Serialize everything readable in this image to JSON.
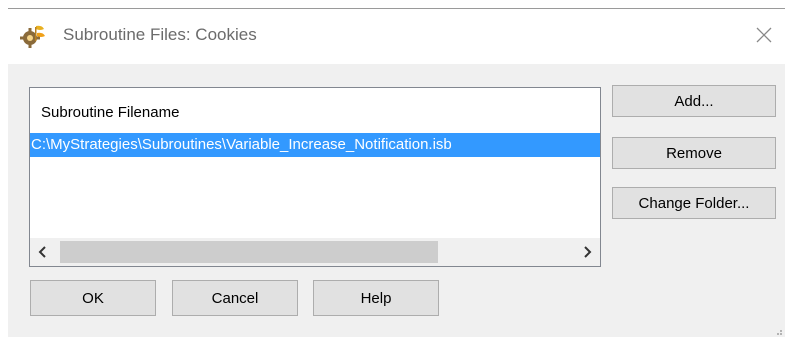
{
  "window": {
    "title": "Subroutine Files: Cookies",
    "app_icon": "gear-plant-icon",
    "close_icon": "close-icon"
  },
  "list": {
    "header": "Subroutine Filename",
    "items": [
      {
        "label": "C:\\MyStrategies\\Subroutines\\Variable_Increase_Notification.isb",
        "selected": true
      }
    ],
    "scroll_left_icon": "chevron-left-icon",
    "scroll_right_icon": "chevron-right-icon"
  },
  "side_buttons": {
    "add": "Add...",
    "remove": "Remove",
    "change_folder": "Change Folder..."
  },
  "bottom_buttons": {
    "ok": "OK",
    "cancel": "Cancel",
    "help": "Help"
  },
  "colors": {
    "selection": "#3399ff",
    "dialog_bg": "#f0f0f0",
    "button_bg": "#e1e1e1"
  }
}
